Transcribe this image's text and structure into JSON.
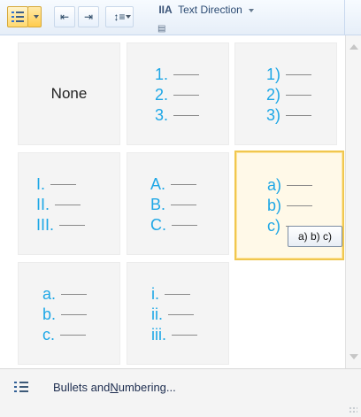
{
  "ribbon": {
    "text_direction_label": "Text Direction"
  },
  "gallery": {
    "tiles": [
      {
        "kind": "none",
        "label": "None"
      },
      {
        "kind": "list",
        "items": [
          "1.",
          "2.",
          "3."
        ]
      },
      {
        "kind": "list",
        "items": [
          "1)",
          "2)",
          "3)"
        ]
      },
      {
        "kind": "list",
        "items": [
          "I.",
          "II.",
          "III."
        ]
      },
      {
        "kind": "list",
        "items": [
          "A.",
          "B.",
          "C."
        ]
      },
      {
        "kind": "list",
        "items": [
          "a)",
          "b)",
          "c)"
        ]
      },
      {
        "kind": "list",
        "items": [
          "a.",
          "b.",
          "c."
        ]
      },
      {
        "kind": "list",
        "items": [
          "i.",
          "ii.",
          "iii."
        ]
      }
    ],
    "selected_tile": 5,
    "tooltip": "a) b) c)"
  },
  "footer": {
    "bullets_prefix": "Bullets and ",
    "bullets_mnemonic": "N",
    "bullets_suffix": "umbering..."
  },
  "colors": {
    "accent": "#1ea7e6",
    "selection_border": "#f0c74f",
    "ribbon_blue": "#2c4b73"
  },
  "icons": {
    "numbering": "numbered-list-icon",
    "bullets": "bullet-list-icon",
    "scroll_up": "scroll-up-icon",
    "scroll_down": "scroll-down-icon"
  }
}
